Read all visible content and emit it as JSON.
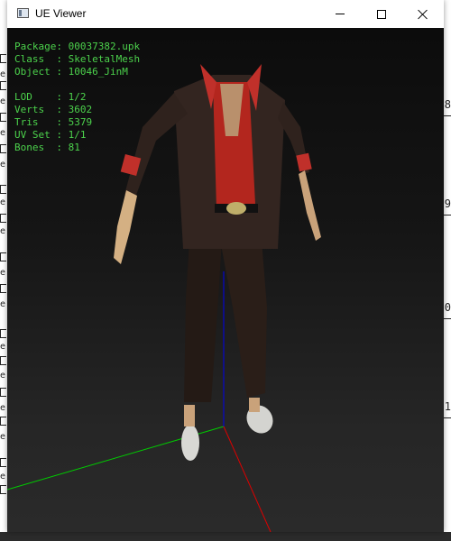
{
  "window": {
    "title": "UE Viewer"
  },
  "info": {
    "package": {
      "label": "Package:",
      "value": "00037382.upk"
    },
    "class": {
      "label": "Class  :",
      "value": "SkeletalMesh"
    },
    "object": {
      "label": "Object :",
      "value": "10046_JinM"
    },
    "lod": {
      "label": "LOD    :",
      "value": "1/2"
    },
    "verts": {
      "label": "Verts  :",
      "value": "3602"
    },
    "tris": {
      "label": "Tris   :",
      "value": "5379"
    },
    "uvset": {
      "label": "UV Set :",
      "value": "1/1"
    },
    "bones": {
      "label": "Bones  :",
      "value": "81"
    }
  },
  "background": {
    "right_numbers": [
      "8",
      "9",
      "0",
      "1"
    ],
    "left_glyphs": [
      "e",
      "e",
      "e",
      "e",
      "e",
      "e",
      "e",
      "e",
      "e",
      "e",
      "e",
      "e",
      "e",
      "e",
      "e",
      "e"
    ]
  },
  "colors": {
    "info_text": "#4cd24c",
    "axis_x": "#00cc00",
    "axis_y": "#dd0000",
    "axis_z": "#0000ee"
  }
}
